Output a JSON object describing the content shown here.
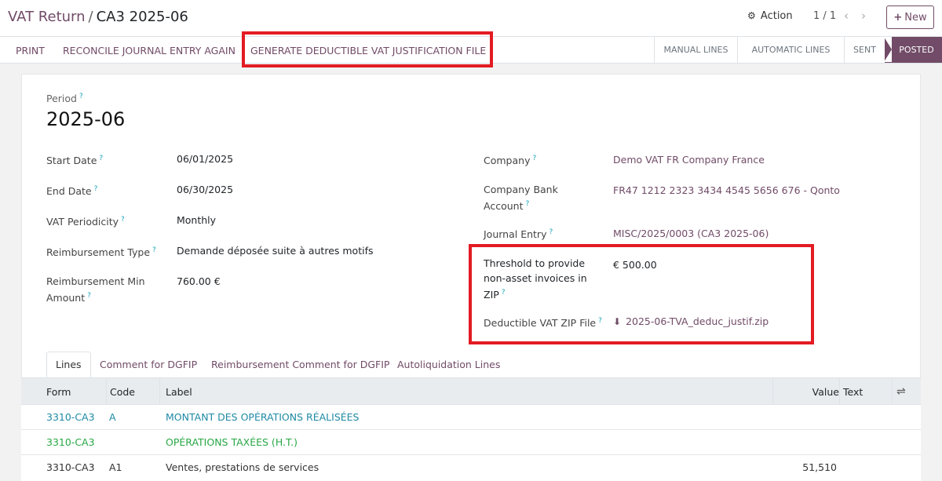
{
  "breadcrumb": {
    "parent": "VAT Return",
    "separator": "/",
    "current": "CA3 2025-06"
  },
  "control": {
    "action_label": "Action",
    "pager": "1 / 1",
    "new_label": "New"
  },
  "buttons": {
    "print": "PRINT",
    "reconcile": "RECONCILE JOURNAL ENTRY AGAIN",
    "generate": "GENERATE DEDUCTIBLE VAT JUSTIFICATION FILE"
  },
  "statusbar": [
    {
      "label": "MANUAL LINES",
      "active": false
    },
    {
      "label": "AUTOMATIC LINES",
      "active": false
    },
    {
      "label": "SENT",
      "active": false
    },
    {
      "label": "POSTED",
      "active": true
    }
  ],
  "form": {
    "period_label": "Period",
    "period_value": "2025-06",
    "left": {
      "start_date": {
        "label": "Start Date",
        "value": "06/01/2025"
      },
      "end_date": {
        "label": "End Date",
        "value": "06/30/2025"
      },
      "vat_periodicity": {
        "label": "VAT Periodicity",
        "value": "Monthly"
      },
      "reimbursement_type": {
        "label": "Reimbursement Type",
        "value": "Demande déposée suite à autres motifs"
      },
      "reimbursement_min_line1": "Reimbursement Min",
      "reimbursement_min_line2": "Amount",
      "reimbursement_min_value": "760.00 €"
    },
    "right": {
      "company": {
        "label": "Company",
        "value": "Demo VAT FR Company France"
      },
      "bank_line1": "Company Bank",
      "bank_line2": "Account",
      "bank_value": "FR47 1212 2323 3434 4545 5656 676 - Qonto",
      "journal_entry": {
        "label": "Journal Entry",
        "value": "MISC/2025/0003 (CA3 2025-06)"
      },
      "threshold_line1": "Threshold to provide",
      "threshold_line2": "non-asset invoices in",
      "threshold_line3": "ZIP",
      "threshold_value": "€ 500.00",
      "zip_label": "Deductible VAT ZIP File",
      "zip_value": "2025-06-TVA_deduc_justif.zip"
    },
    "tooltip_mark": "?"
  },
  "tabs": [
    "Lines",
    "Comment for DGFIP",
    "Reimbursement Comment for DGFIP",
    "Autoliquidation Lines"
  ],
  "table": {
    "headers": {
      "form": "Form",
      "code": "Code",
      "label": "Label",
      "value": "Value",
      "text": "Text"
    },
    "rows": [
      {
        "form": "3310-CA3",
        "code": "A",
        "label": "MONTANT DES OPÉRATIONS RÉALISÉES",
        "value": ""
      },
      {
        "form": "3310-CA3",
        "code": "",
        "label": "OPÉRATIONS TAXÉES (H.T.)",
        "value": ""
      },
      {
        "form": "3310-CA3",
        "code": "A1",
        "label": "Ventes, prestations de services",
        "value": "51,510"
      }
    ]
  },
  "colors": {
    "brand": "#714b67",
    "highlight": "#e31b23",
    "teal": "#1f8aa5",
    "green": "#28a745"
  }
}
